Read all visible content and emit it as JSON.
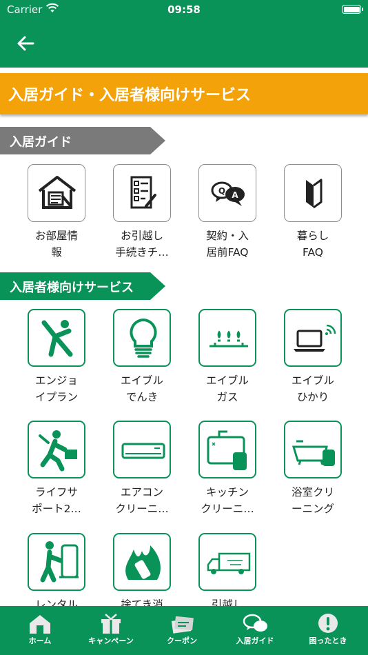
{
  "status_bar": {
    "carrier": "Carrier",
    "time": "09:58"
  },
  "nav": {
    "back_icon": "arrow-left-icon"
  },
  "banner": {
    "title": "入居ガイド・入居者様向けサービス",
    "color": "#f4a20a"
  },
  "colors": {
    "brand_green": "#0a9359",
    "gray_tag": "#7a7a7a"
  },
  "guide_section": {
    "title": "入居ガイド",
    "items": [
      {
        "label_line1": "お部屋情",
        "label_line2": "報",
        "icon": "house-document-icon"
      },
      {
        "label_line1": "お引越し",
        "label_line2": "手続きチ…",
        "icon": "checklist-icon"
      },
      {
        "label_line1": "契約・入",
        "label_line2": "居前FAQ",
        "icon": "qa-bubbles-icon"
      },
      {
        "label_line1": "暮らし",
        "label_line2": "FAQ",
        "icon": "beginner-mark-icon"
      }
    ]
  },
  "services_section": {
    "title": "入居者様向けサービス",
    "items": [
      {
        "label_line1": "エンジョ",
        "label_line2": "イプラン",
        "icon": "jumping-person-icon"
      },
      {
        "label_line1": "エイブル",
        "label_line2": "でんき",
        "icon": "light-bulb-icon"
      },
      {
        "label_line1": "エイブル",
        "label_line2": "ガス",
        "icon": "gas-stove-icon"
      },
      {
        "label_line1": "エイブル",
        "label_line2": "ひかり",
        "icon": "laptop-wifi-icon"
      },
      {
        "label_line1": "ライフサ",
        "label_line2": "ポート2…",
        "icon": "repairman-icon"
      },
      {
        "label_line1": "エアコン",
        "label_line2": "クリーニ…",
        "icon": "air-conditioner-icon"
      },
      {
        "label_line1": "キッチン",
        "label_line2": "クリーニ…",
        "icon": "kitchen-sink-icon"
      },
      {
        "label_line1": "浴室クリ",
        "label_line2": "ーニング",
        "icon": "bathtub-icon"
      },
      {
        "label_line1": "レンタル",
        "label_line2": "",
        "icon": "hand-truck-icon"
      },
      {
        "label_line1": "捨てき消",
        "label_line2": "",
        "icon": "fire-battery-icon"
      },
      {
        "label_line1": "引越し",
        "label_line2": "",
        "icon": "moving-truck-icon"
      }
    ]
  },
  "tab_bar": {
    "tabs": [
      {
        "label": "ホーム",
        "icon": "home-icon"
      },
      {
        "label": "キャンペーン",
        "icon": "gift-icon"
      },
      {
        "label": "クーポン",
        "icon": "coupon-icon"
      },
      {
        "label": "入居ガイド",
        "icon": "chat-bubbles-icon",
        "active": true
      },
      {
        "label": "困ったとき",
        "icon": "exclamation-icon"
      }
    ]
  }
}
